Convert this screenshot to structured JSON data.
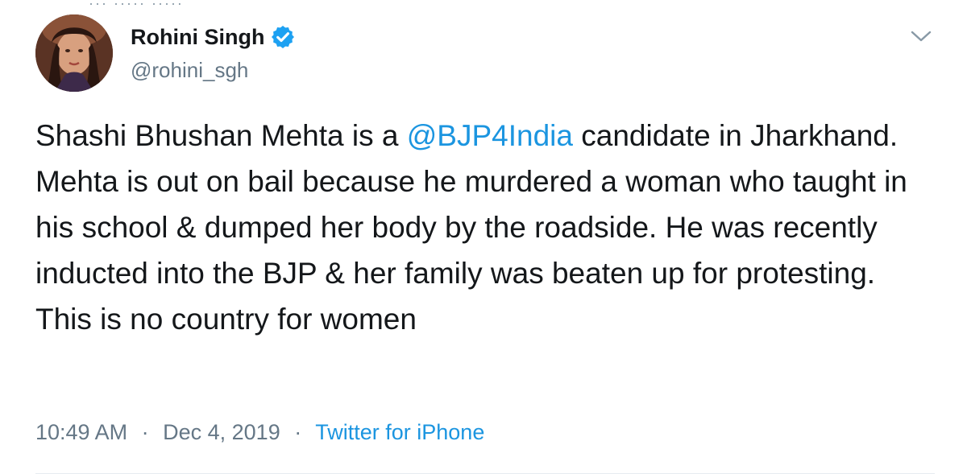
{
  "header": {
    "top_fragment": "··· ····· ·····"
  },
  "tweet": {
    "author": {
      "display_name": "Rohini Singh",
      "handle": "@rohini_sgh",
      "verified": true
    },
    "text_parts": {
      "before_mention": "Shashi Bhushan Mehta is a ",
      "mention": "@BJP4India",
      "after_mention": " candidate in Jharkhand. Mehta is out on bail because he murdered a woman who taught in his school & dumped her body by the roadside. He was recently inducted into the BJP & her family was beaten up for protesting. This is no country for women"
    },
    "time": "10:49 AM",
    "separator": "·",
    "date": "Dec 4, 2019",
    "source": "Twitter for iPhone"
  },
  "colors": {
    "text": "#14171a",
    "secondary": "#657786",
    "link": "#1b95e0",
    "verified": "#1da1f2"
  },
  "icons": {
    "verified": "verified-badge-icon",
    "menu": "chevron-down-icon"
  }
}
